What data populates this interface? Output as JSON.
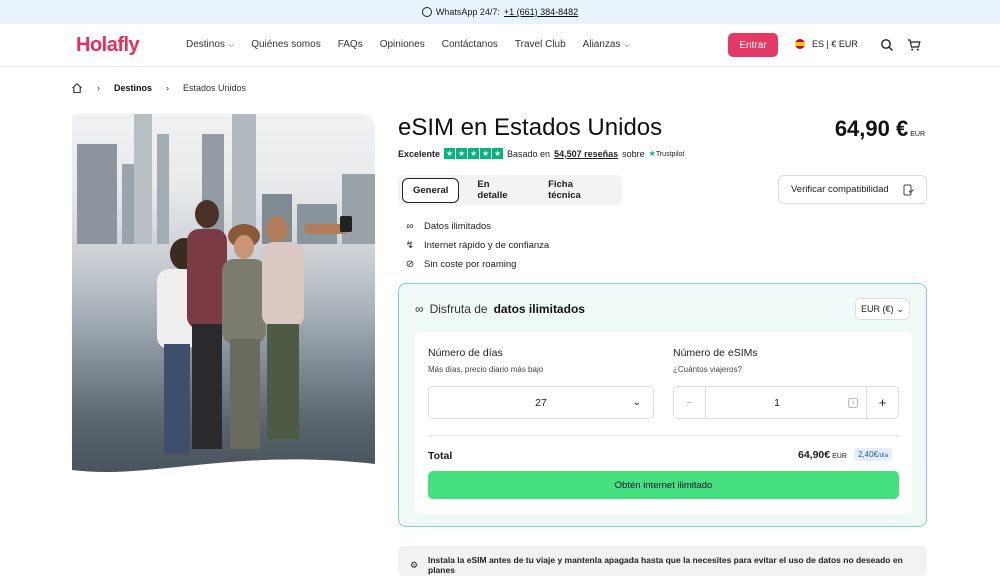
{
  "topbar": {
    "whatsapp_label": "WhatsApp 24/7:",
    "phone": "+1 (661) 384-8482"
  },
  "header": {
    "logo": "Holafly",
    "nav": [
      {
        "label": "Destinos",
        "has_dropdown": true
      },
      {
        "label": "Quiénes somos",
        "has_dropdown": false
      },
      {
        "label": "FAQs",
        "has_dropdown": false
      },
      {
        "label": "Opiniones",
        "has_dropdown": false
      },
      {
        "label": "Contáctanos",
        "has_dropdown": false
      },
      {
        "label": "Travel Club",
        "has_dropdown": false
      },
      {
        "label": "Alianzas",
        "has_dropdown": true
      }
    ],
    "login_label": "Entrar",
    "locale_label": "ES | € EUR"
  },
  "breadcrumb": {
    "items": [
      "Destinos",
      "Estados Unidos"
    ]
  },
  "product": {
    "title": "eSIM en Estados Unidos",
    "price": "64,90 €",
    "price_currency": "EUR",
    "rating_label": "Excelente",
    "based_on": "Basado en",
    "reviews": "54,507 reseñas",
    "on": "sobre",
    "trustpilot": "Trustpilot"
  },
  "tabs": [
    "General",
    "En detalle",
    "Ficha técnica"
  ],
  "verify_label": "Verificar compatibilidad",
  "features": [
    {
      "icon": "infinity-icon",
      "label": "Datos ilimitados"
    },
    {
      "icon": "bolt-icon",
      "label": "Internet rápido y de confianza"
    },
    {
      "icon": "no-roaming-icon",
      "label": "Sin coste por roaming"
    }
  ],
  "plan": {
    "heading_prefix": "Disfruta de",
    "heading_bold": "datos ilimitados",
    "currency_select": "EUR (€)",
    "days_label": "Número de días",
    "days_sub": "Más días, precio diario más bajo",
    "days_value": "27",
    "esims_label": "Número de eSIMs",
    "esims_sub": "¿Cuántos viajeros?",
    "esims_value": "1",
    "total_label": "Total",
    "total_value": "64,90€",
    "total_currency": "EUR",
    "per_day": "2,40€",
    "per_day_unit": "/día",
    "buy_label": "Obtén internet ilimitado"
  },
  "notice": "Instala la eSIM antes de tu viaje y mantenla apagada hasta que la necesites para evitar el uso de datos no deseado en planes"
}
